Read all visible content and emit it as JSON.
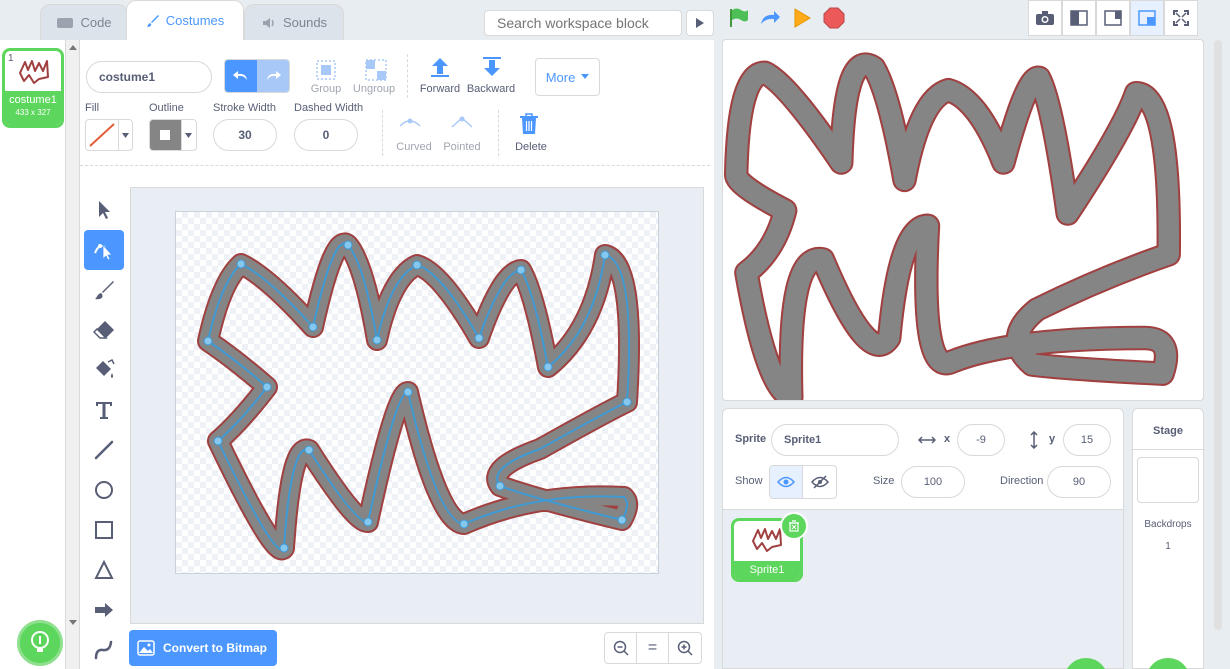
{
  "tabs": [
    {
      "label": "Code",
      "icon": "code-icon"
    },
    {
      "label": "Costumes",
      "icon": "brush-icon"
    },
    {
      "label": "Sounds",
      "icon": "speaker-icon"
    }
  ],
  "search": {
    "placeholder": "Search workspace block"
  },
  "costume_list": [
    {
      "index": "1",
      "name": "costume1",
      "size": "433 x 327"
    }
  ],
  "editor": {
    "costume_name": "costume1",
    "group_label": "Group",
    "ungroup_label": "Ungroup",
    "forward_label": "Forward",
    "backward_label": "Backward",
    "more_label": "More",
    "fill_label": "Fill",
    "outline_label": "Outline",
    "stroke_width_label": "Stroke Width",
    "stroke_width_value": "30",
    "dashed_width_label": "Dashed Width",
    "dashed_width_value": "0",
    "curved_label": "Curved",
    "pointed_label": "Pointed",
    "delete_label": "Delete",
    "convert_label": "Convert to Bitmap",
    "zoom_reset_label": "="
  },
  "tools": [
    "select-tool",
    "reshape-tool",
    "brush-tool",
    "eraser-tool",
    "fill-tool",
    "text-tool",
    "line-tool",
    "circle-tool",
    "rectangle-tool",
    "triangle-tool",
    "arrow-tool",
    "curve-tool"
  ],
  "sprite_info": {
    "sprite_label": "Sprite",
    "sprite_name": "Sprite1",
    "x_label": "x",
    "x_value": "-9",
    "y_label": "y",
    "y_value": "15",
    "show_label": "Show",
    "size_label": "Size",
    "size_value": "100",
    "direction_label": "Direction",
    "direction_value": "90"
  },
  "sprites": [
    {
      "name": "Sprite1"
    }
  ],
  "stage_panel": {
    "title": "Stage",
    "backdrops_label": "Backdrops",
    "backdrops_count": "1"
  },
  "colors": {
    "accent": "#4c97ff",
    "green": "#5cd65c",
    "stroke": "#a04040",
    "fill": "#858585"
  }
}
